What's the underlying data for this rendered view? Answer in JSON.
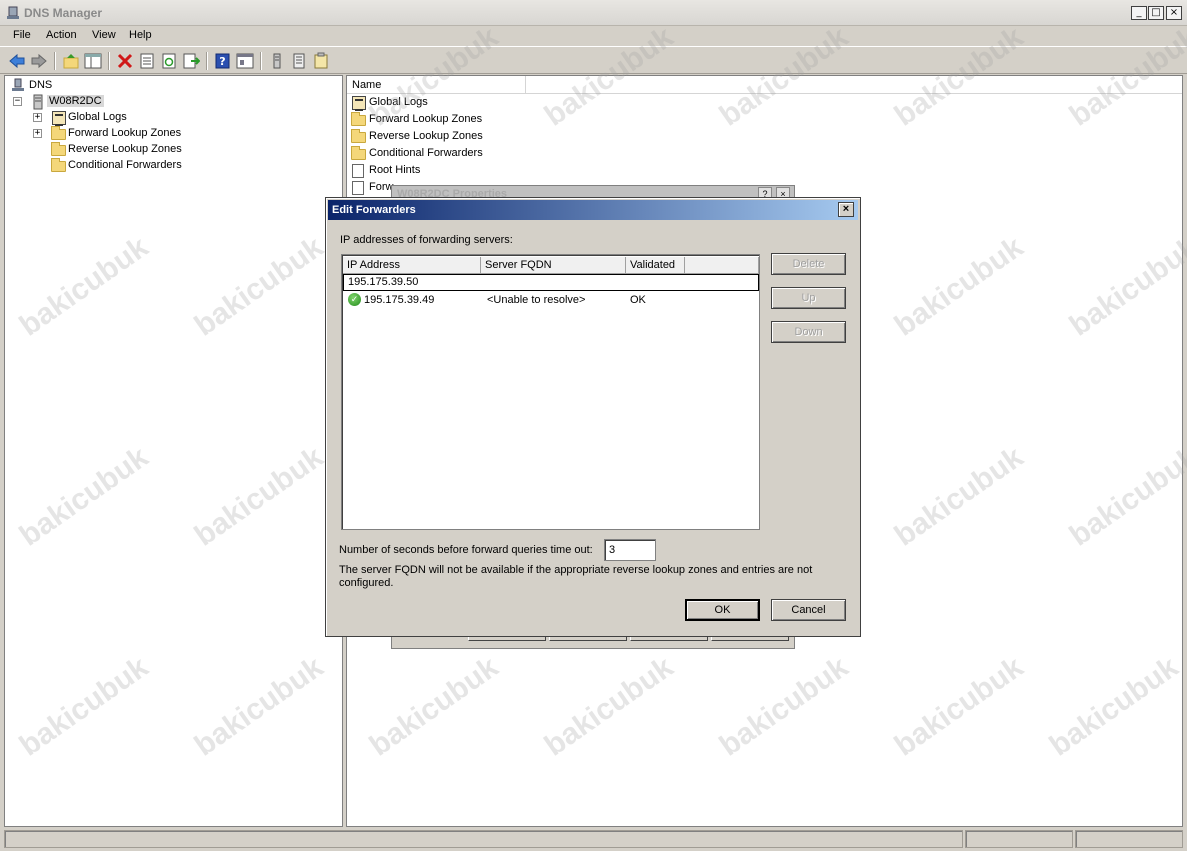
{
  "window": {
    "title": "DNS Manager"
  },
  "menu": [
    "File",
    "Action",
    "View",
    "Help"
  ],
  "toolbar_icons": [
    "back-icon",
    "forward-icon",
    "up-icon",
    "show-hide-tree-icon",
    "delete-icon",
    "properties-icon",
    "refresh-icon",
    "export-icon",
    "help-icon",
    "view-icon",
    "server-icon",
    "list-icon",
    "notes-icon"
  ],
  "tree": {
    "root": "DNS",
    "server": "W08R2DC",
    "children": [
      "Global Logs",
      "Forward Lookup Zones",
      "Reverse Lookup Zones",
      "Conditional Forwarders"
    ]
  },
  "list": {
    "column": "Name",
    "items": [
      "Global Logs",
      "Forward Lookup Zones",
      "Reverse Lookup Zones",
      "Conditional Forwarders",
      "Root Hints",
      "Forw"
    ]
  },
  "props_dialog": {
    "title": "W08R2DC Properties",
    "help": "?",
    "close": "×"
  },
  "edit_forwarders": {
    "title": "Edit Forwarders",
    "label": "IP addresses of forwarding servers:",
    "columns": [
      "IP Address",
      "Server FQDN",
      "Validated"
    ],
    "edit_value": "195.175.39.50",
    "rows": [
      {
        "ip": "195.175.39.49",
        "fqdn": "<Unable to resolve>",
        "validated": "OK"
      }
    ],
    "buttons": {
      "delete": "Delete",
      "up": "Up",
      "down": "Down",
      "ok": "OK",
      "cancel": "Cancel"
    },
    "timeout_label": "Number of seconds before forward queries time out:",
    "timeout_value": "3",
    "note": "The server FQDN will not be available if the appropriate reverse lookup zones and entries are not configured."
  },
  "watermark": "bakicubuk",
  "colors": {
    "dialog_title_start": "#0a246a",
    "dialog_title_end": "#a6caf0",
    "folder": "#f4d77a"
  }
}
